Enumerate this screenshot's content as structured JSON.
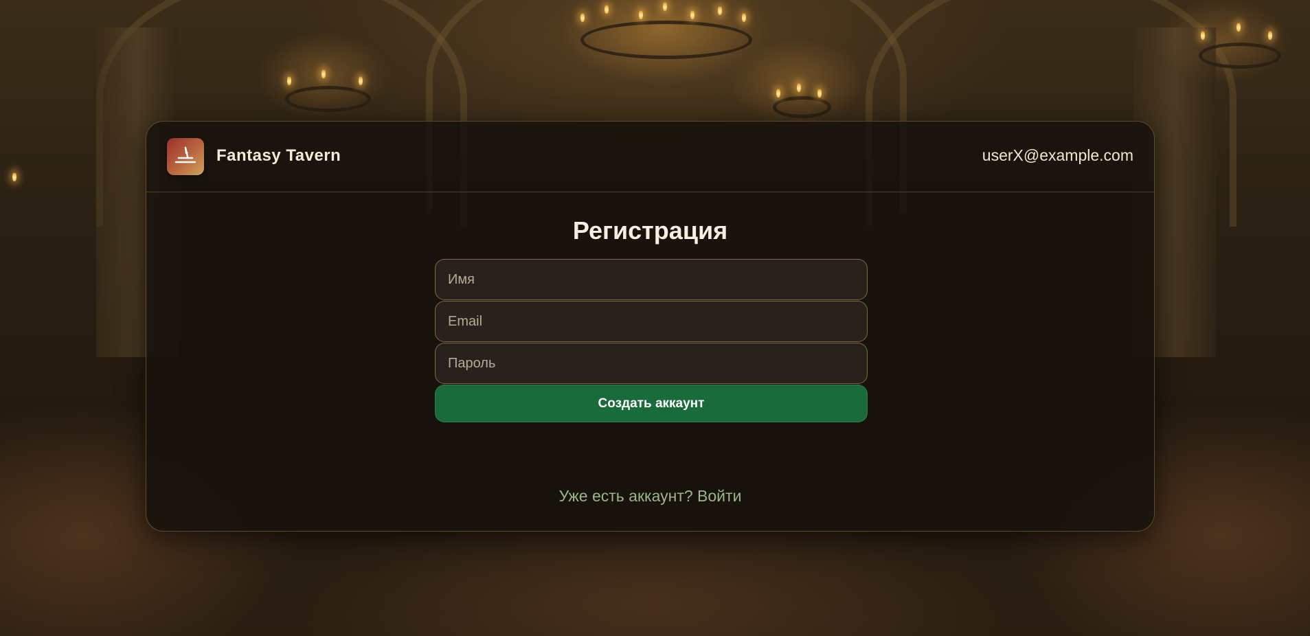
{
  "app": {
    "name": "Fantasy Tavern",
    "logo_icon": "feather-quill-icon",
    "accent_color": "#1a6b3c"
  },
  "header": {
    "user_email": "userX@example.com"
  },
  "form": {
    "title": "Регистрация",
    "name_placeholder": "Имя",
    "email_placeholder": "Email",
    "password_placeholder": "Пароль",
    "submit_label": "Создать аккаунт"
  },
  "footer": {
    "login_link": "Уже есть аккаунт? Войти"
  }
}
